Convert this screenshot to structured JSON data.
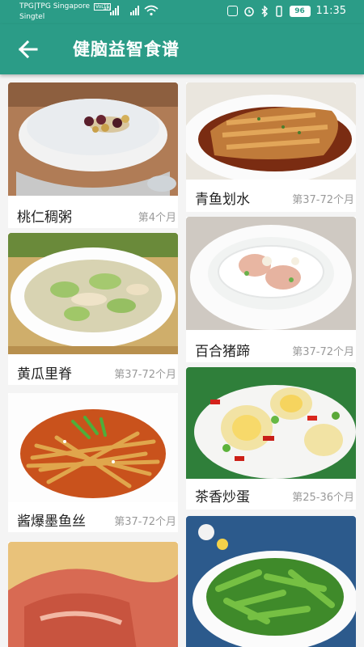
{
  "status": {
    "carrier_line1": "TPG|TPG Singapore",
    "carrier_line2": "Singtel",
    "volte": "VoLTE",
    "network": "4G",
    "battery": "96",
    "time": "11:35"
  },
  "appbar": {
    "title": "健脑益智食谱"
  },
  "recipes": [
    {
      "name": "桃仁稠粥",
      "age": "第4个月"
    },
    {
      "name": "青鱼划水",
      "age": "第37-72个月"
    },
    {
      "name": "黄瓜里脊",
      "age": "第37-72个月"
    },
    {
      "name": "百合猪蹄",
      "age": "第37-72个月"
    },
    {
      "name": "酱爆墨鱼丝",
      "age": "第37-72个月"
    },
    {
      "name": "茶香炒蛋",
      "age": "第25-36个月"
    },
    {
      "name": "",
      "age": ""
    },
    {
      "name": "",
      "age": ""
    }
  ]
}
